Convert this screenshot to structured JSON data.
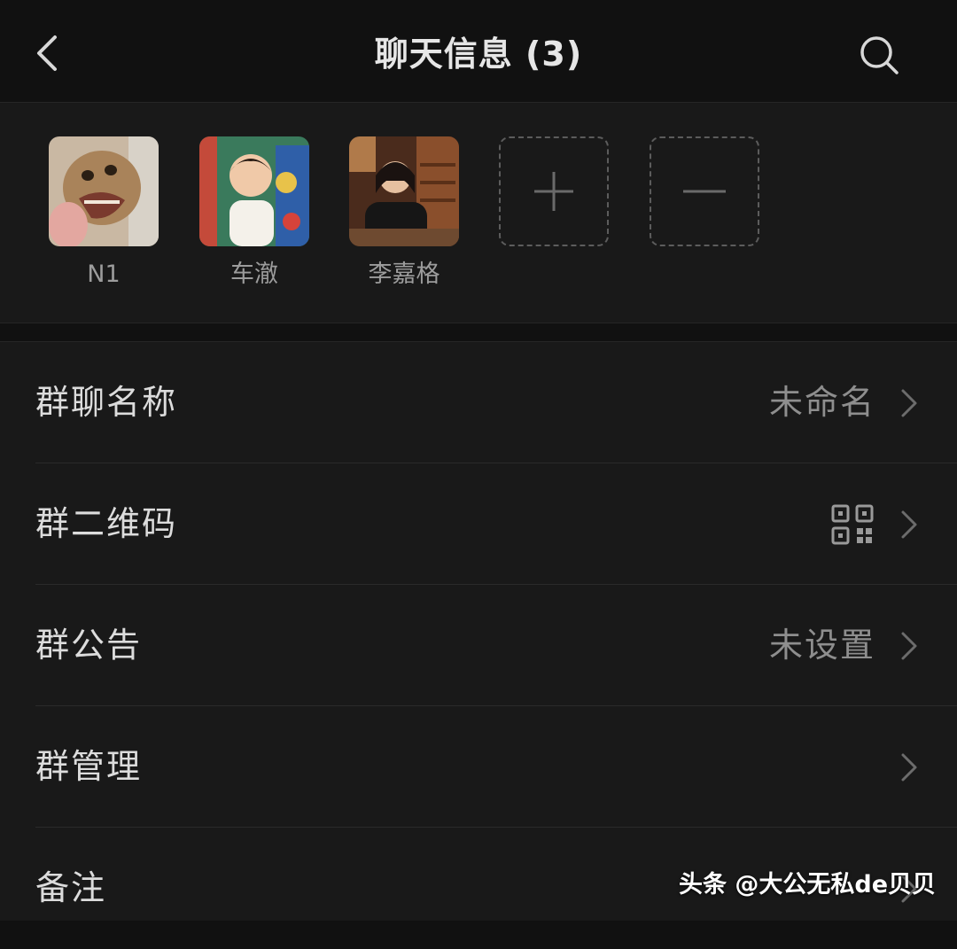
{
  "header": {
    "title": "聊天信息 (3)",
    "back_icon": "chevron-left-icon",
    "search_icon": "search-icon"
  },
  "members": [
    {
      "name": "N1",
      "avatar": "lion-photo"
    },
    {
      "name": "车澈",
      "avatar": "child-photo"
    },
    {
      "name": "李嘉格",
      "avatar": "woman-photo"
    }
  ],
  "member_actions": {
    "add_icon": "plus-icon",
    "remove_icon": "minus-icon"
  },
  "settings": [
    {
      "label": "群聊名称",
      "value": "未命名"
    },
    {
      "label": "群二维码",
      "value": "",
      "icon": "qr-code-icon"
    },
    {
      "label": "群公告",
      "value": "未设置"
    },
    {
      "label": "群管理",
      "value": ""
    },
    {
      "label": "备注",
      "value": ""
    }
  ],
  "watermark": {
    "text": "头条 @大公无私de贝贝"
  },
  "colors": {
    "background": "#111111",
    "panel": "#191919",
    "text": "#dcdcdc",
    "muted": "#8e8e8e"
  }
}
